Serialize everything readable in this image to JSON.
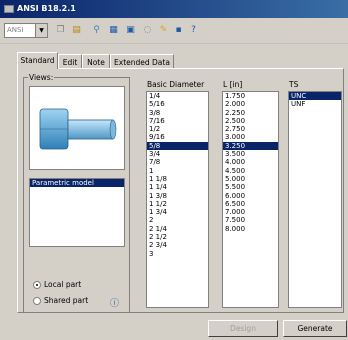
{
  "window": {
    "title": "ANSI B18.2.1"
  },
  "toolbar": {
    "standard_value": "ANSI"
  },
  "tabs": [
    "Standard",
    "Edit",
    "Note",
    "Extended Data"
  ],
  "views": {
    "label": "Views:",
    "list": [
      "Parametric model"
    ],
    "radio_local": "Local part",
    "radio_shared": "Shared part"
  },
  "columns": {
    "basic_diameter": {
      "header": "Basic Diameter",
      "items": [
        "1/4",
        "5/16",
        "3/8",
        "7/16",
        "1/2",
        "9/16",
        "5/8",
        "3/4",
        "7/8",
        "1",
        "1 1/8",
        "1 1/4",
        "1 3/8",
        "1 1/2",
        "1 3/4",
        "2",
        "2 1/4",
        "2 1/2",
        "2 3/4",
        "3"
      ],
      "selected": "5/8"
    },
    "length": {
      "header": "L [in]",
      "items": [
        "1.750",
        "2.000",
        "2.250",
        "2.500",
        "2.750",
        "3.000",
        "3.250",
        "3.500",
        "4.000",
        "4.500",
        "5.000",
        "5.500",
        "6.000",
        "6.500",
        "7.000",
        "7.500",
        "8.000"
      ],
      "selected": "3.250"
    },
    "ts": {
      "header": "TS",
      "items": [
        "UNC",
        "UNF"
      ],
      "selected": "UNC"
    }
  },
  "buttons": {
    "design": "Design",
    "generate": "Generate"
  }
}
